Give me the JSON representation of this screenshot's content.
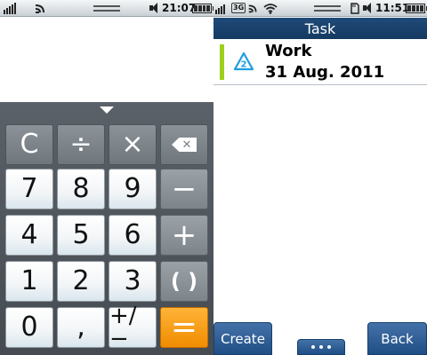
{
  "status_left": {
    "time": "21:07"
  },
  "status_right": {
    "time": "11:51",
    "network": "3G"
  },
  "calculator": {
    "keys": {
      "clear": "C",
      "divide": "÷",
      "multiply": "×",
      "seven": "7",
      "eight": "8",
      "nine": "9",
      "minus": "−",
      "four": "4",
      "five": "5",
      "six": "6",
      "plus": "+",
      "one": "1",
      "two": "2",
      "three": "3",
      "parens": "( )",
      "zero": "0",
      "comma": ",",
      "sign": "+/−",
      "equals": "="
    },
    "icons": {
      "backspace": "backspace-icon",
      "collapse": "collapse-arrow-icon"
    }
  },
  "task": {
    "header": "Task",
    "items": [
      {
        "title": "Work",
        "date": "31 Aug. 2011",
        "priority": "2",
        "status_color": "#9ecf1a"
      }
    ],
    "softkeys": {
      "create": "Create",
      "back": "Back"
    }
  },
  "colors": {
    "header": "#1f4a78",
    "equals_key": "#f08c00",
    "priority_icon": "#1e9ee0"
  }
}
